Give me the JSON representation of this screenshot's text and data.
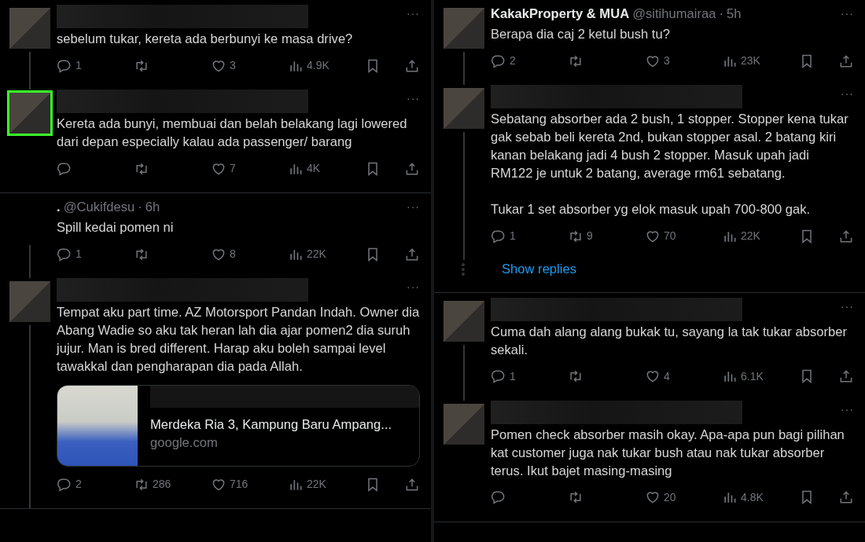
{
  "columns": [
    {
      "threads": [
        {
          "tweets": [
            {
              "redacted": true,
              "avatar": true,
              "highlighted": false,
              "thread_below": true,
              "more": "···",
              "text": "sebelum tukar, kereta ada berbunyi ke masa drive?",
              "reply": "1",
              "like": "3",
              "views": "4.9K"
            },
            {
              "redacted": true,
              "avatar": true,
              "highlighted": true,
              "thread_below": false,
              "more": "···",
              "text": "Kereta ada bunyi, membuai dan belah belakang lagi lowered dari depan especially kalau ada passenger/ barang",
              "like": "7",
              "views": "4K"
            }
          ]
        },
        {
          "tweets": [
            {
              "redacted": false,
              "avatar": false,
              "thread_below": true,
              "name": ".",
              "handle": "@Cukifdesu",
              "separator": "·",
              "time": "6h",
              "more": "···",
              "text": "Spill kedai pomen ni",
              "reply": "1",
              "like": "8",
              "views": "22K"
            },
            {
              "redacted": true,
              "avatar": true,
              "highlighted": false,
              "thread_below": true,
              "more": "···",
              "text": "Tempat aku part time. AZ Motorsport Pandan Indah. Owner dia Abang Wadie so aku tak heran lah dia ajar pomen2 dia suruh jujur. Man is bred different. Harap aku boleh sampai level tawakkal dan pengharapan dia pada Allah.",
              "link_card": {
                "title": "Merdeka Ria 3, Kampung Baru Ampang...",
                "domain": "google.com"
              },
              "reply": "2",
              "retweet": "286",
              "like": "716",
              "views": "22K"
            }
          ]
        }
      ]
    },
    {
      "threads": [
        {
          "tweets": [
            {
              "redacted": false,
              "avatar": true,
              "highlighted": false,
              "thread_below": true,
              "name": "KakakProperty & MUA",
              "handle": "@sitihumairaa",
              "separator": "·",
              "time": "5h",
              "more": "···",
              "text": "Berapa dia caj 2 ketul bush tu?",
              "reply": "2",
              "like": "3",
              "views": "23K"
            },
            {
              "redacted": true,
              "avatar": true,
              "highlighted": false,
              "thread_below": true,
              "more": "···",
              "text": "Sebatang absorber ada 2 bush, 1 stopper. Stopper kena tukar gak sebab beli kereta 2nd, bukan stopper asal. 2 batang kiri kanan belakang jadi 4 bush 2 stopper. Masuk upah jadi RM122 je untuk 2 batang, average rm61 sebatang.\n\nTukar 1 set absorber yg elok masuk upah 700-800 gak.",
              "reply": "1",
              "retweet": "9",
              "like": "70",
              "views": "22K"
            }
          ],
          "show_replies": "Show replies"
        },
        {
          "tweets": [
            {
              "redacted": true,
              "avatar": true,
              "highlighted": false,
              "thread_below": true,
              "more": "···",
              "text": "Cuma dah alang alang bukak tu, sayang la tak tukar absorber sekali.",
              "reply": "1",
              "like": "4",
              "views": "6.1K"
            },
            {
              "redacted": true,
              "avatar": true,
              "highlighted": false,
              "thread_below": false,
              "more": "···",
              "text": "Pomen check absorber masih okay. Apa-apa pun bagi pilihan kat customer juga nak tukar bush atau nak tukar absorber terus. Ikut bajet masing-masing",
              "like": "20",
              "views": "4.8K"
            }
          ]
        }
      ]
    }
  ]
}
